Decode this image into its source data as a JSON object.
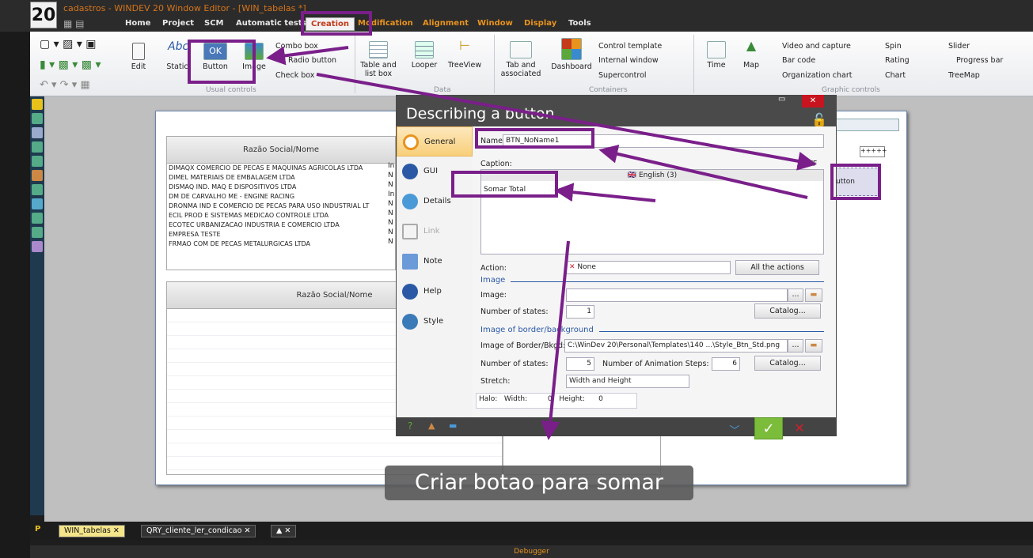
{
  "app": {
    "logo": "20",
    "title": "cadastros - WINDEV 20  Window Editor - [WIN_tabelas *]"
  },
  "menu": [
    "Home",
    "Project",
    "SCM",
    "Automatic tests",
    "Creation",
    "Modification",
    "Alignment",
    "Window",
    "Display",
    "Tools"
  ],
  "ribbon": {
    "usual": {
      "edit": "Edit",
      "static_icon": "Abc",
      "static": "Static",
      "button_icon": "OK",
      "button": "Button",
      "image": "Image",
      "combo": "Combo box",
      "radio": "Radio button",
      "check": "Check box",
      "group": "Usual controls"
    },
    "data": {
      "table": "Table and list box",
      "looper": "Looper",
      "treeview": "TreeView",
      "group": "Data"
    },
    "containers": {
      "tab": "Tab and associated",
      "dashboard": "Dashboard",
      "control_template": "Control template",
      "internal_window": "Internal window",
      "supercontrol": "Supercontrol",
      "group": "Containers"
    },
    "graphic": {
      "time": "Time",
      "map": "Map",
      "video": "Video and capture",
      "barcode": "Bar code",
      "org": "Organization chart",
      "spin": "Spin",
      "rating": "Rating",
      "chart": "Chart",
      "slider": "Slider",
      "progress": "Progress bar",
      "treemap": "TreeMap",
      "group": "Graphic controls"
    }
  },
  "table1": {
    "header": "Razão Social/Nome",
    "rows": [
      "DIMAQX COMERCIO DE PECAS E MAQUINAS AGRICOLAS LTDA",
      "DIMEL MATERIAIS DE EMBALAGEM LTDA",
      "DISMAQ IND. MAQ E DISPOSITIVOS LTDA",
      "DM DE CARVALHO ME - ENGINE RACING",
      "DRONMA IND E COMERCIO DE PECAS PARA USO INDUSTRIAL LT",
      "ECIL PROD E SISTEMAS MEDICAO CONTROLE LTDA",
      "ECOTEC URBANIZACAO INDUSTRIA E COMERCIO LTDA",
      "EMPRESA TESTE",
      "FRMAO COM DE PECAS METALURGICAS LTDA"
    ],
    "side": [
      "In",
      "N",
      "N",
      "In",
      "N",
      "N",
      "N",
      "N",
      "N"
    ]
  },
  "table2": {
    "header": "Razão Social/Nome"
  },
  "editor_bg": {
    "button_label": "utton",
    "field_value": "+++++"
  },
  "dialog": {
    "title": "Describing a button",
    "nav": [
      "General",
      "GUI",
      "Details",
      "Link",
      "Note",
      "Help",
      "Style"
    ],
    "name_label": "Name:",
    "name_value": "BTN_NoName1",
    "caption_label": "Caption:",
    "lang": "English (3)",
    "caption_value": "Somar Total",
    "rtf": "RTF",
    "action_label": "Action:",
    "action_value": "None",
    "all_actions": "All the actions",
    "image_section": "Image",
    "image_label": "Image:",
    "states_label": "Number of states:",
    "states_value": "1",
    "catalog": "Catalog...",
    "browse": "...",
    "border_section": "Image of border/background",
    "border_label": "Image of Border/Bkgd:",
    "border_value": "C:\\WinDev 20\\Personal\\Templates\\140 ...\\Style_Btn_Std.png",
    "states2_value": "5",
    "anim_label": "Number of Animation Steps:",
    "anim_value": "6",
    "stretch_label": "Stretch:",
    "stretch_value": "Width and Height",
    "halo_label": "Halo:",
    "width_label": "Width:",
    "width_value": "0",
    "height_label": "Height:",
    "height_value": "0"
  },
  "caption": "Criar botao para somar",
  "bottom_tabs": [
    "WIN_tabelas",
    "QRY_cliente_ler_condicao",
    ""
  ],
  "debugger": "Debugger",
  "colors": {
    "annotation": "#7a1f8a",
    "accent": "#e8931e"
  }
}
